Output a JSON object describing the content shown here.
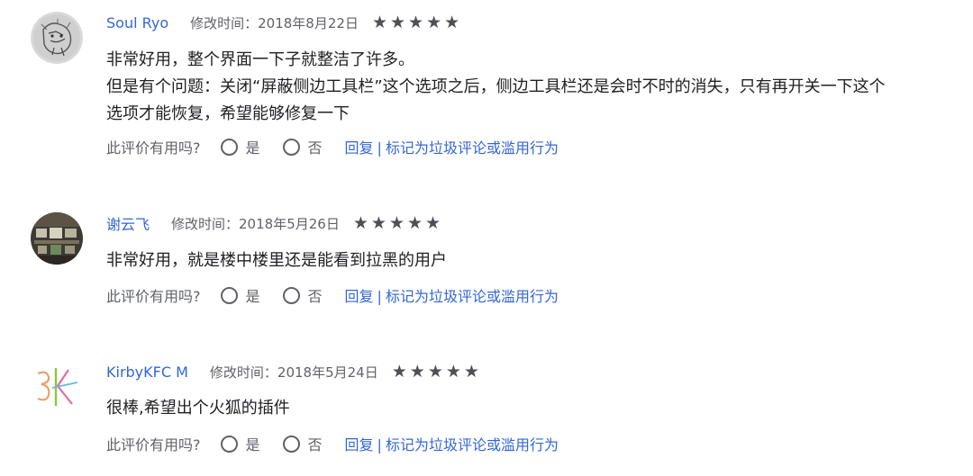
{
  "helpful_prompt": "此评价有用吗?",
  "yes_label": "是",
  "no_label": "否",
  "reply_label": "回复",
  "separator": "|",
  "report_label": "标记为垃圾评论或滥用行为",
  "star_glyph": "★",
  "reviews": [
    {
      "author": "Soul Ryo",
      "modified": "修改时间：2018年8月22日",
      "rating": 5,
      "avatar_icon": "sketch-drawing-avatar",
      "lines": [
        "非常好用，整个界面一下子就整洁了许多。",
        "但是有个问题：关闭“屏蔽侧边工具栏”这个选项之后，侧边工具栏还是会时不时的消失，只有再开关一下这个",
        "选项才能恢复，希望能够修复一下"
      ]
    },
    {
      "author": "谢云飞",
      "modified": "修改时间：2018年5月26日",
      "rating": 5,
      "avatar_icon": "photo-avatar",
      "lines": [
        "非常好用，就是楼中楼里还是能看到拉黑的用户"
      ]
    },
    {
      "author": "KirbyKFC M",
      "modified": "修改时间：2018年5月24日",
      "rating": 5,
      "avatar_icon": "calligraphy-logo-avatar",
      "lines": [
        "很棒,希望出个火狐的插件"
      ]
    }
  ],
  "colors": {
    "link": "#3367d6",
    "star": "#4d5156",
    "muted": "#5f6368",
    "text": "#202124"
  }
}
